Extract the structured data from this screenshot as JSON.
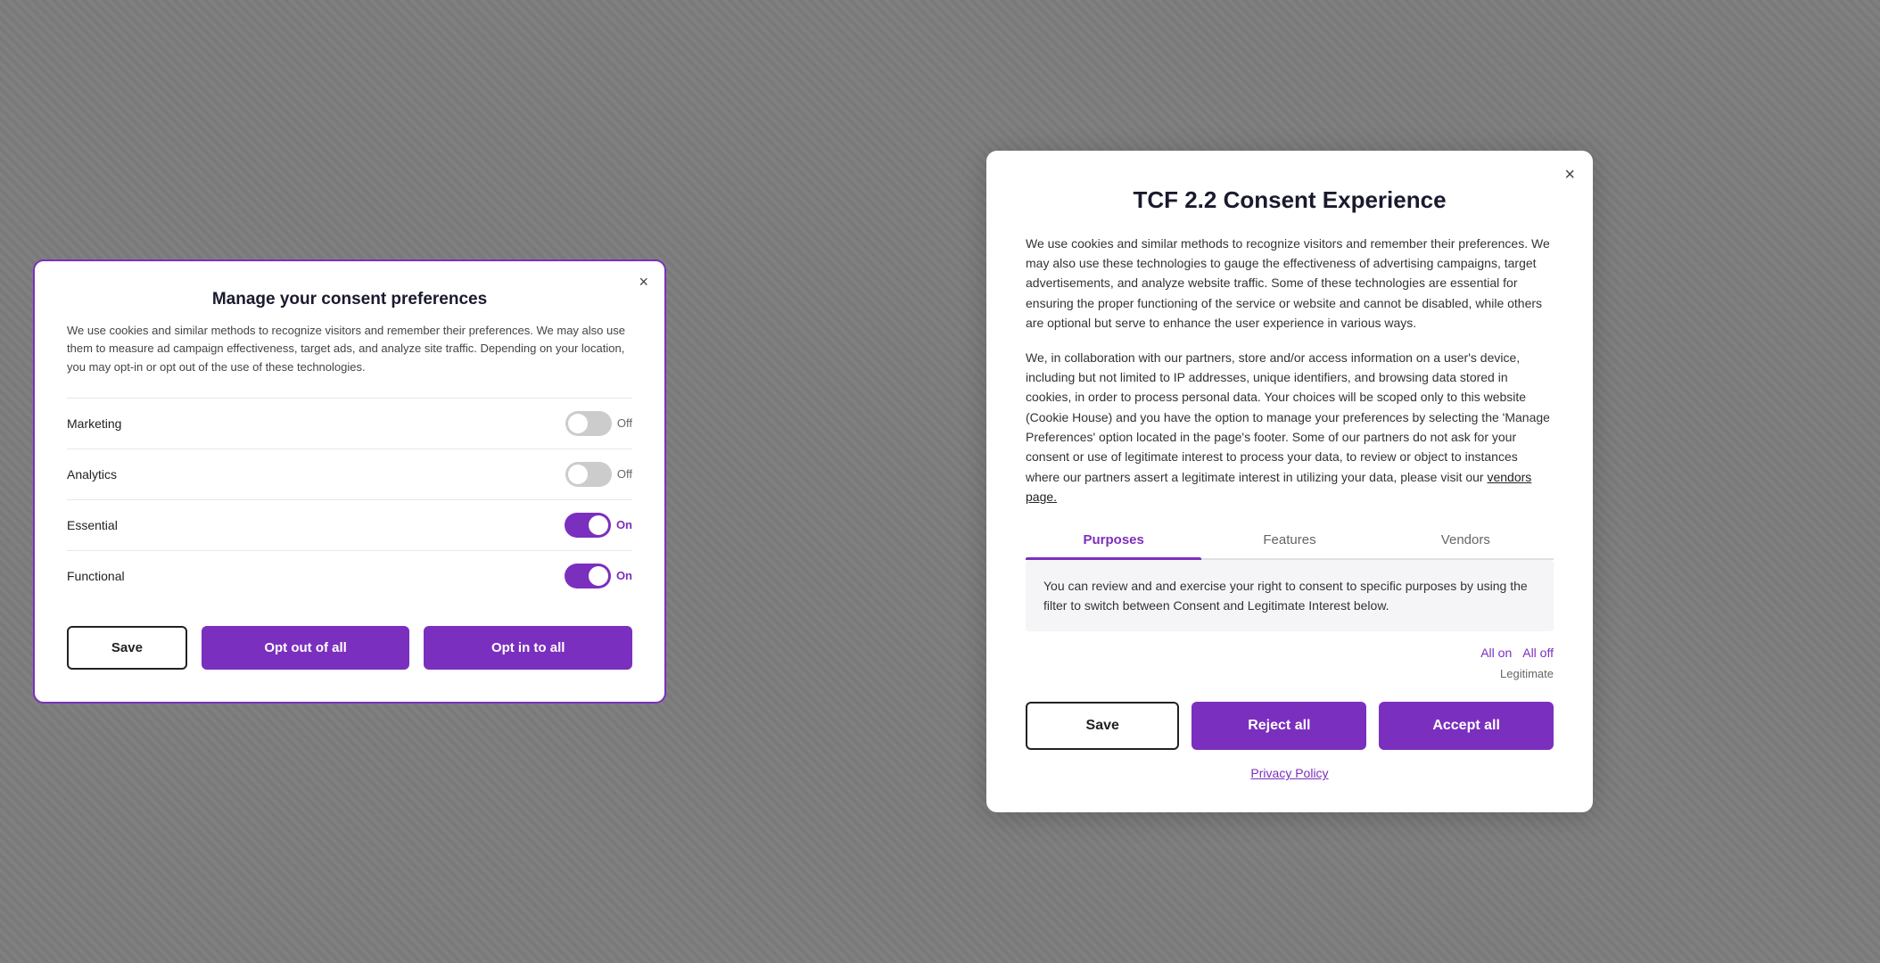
{
  "left_modal": {
    "title": "Manage your consent preferences",
    "description": "We use cookies and similar methods to recognize visitors and remember their preferences. We may also use them to measure ad campaign effectiveness, target ads, and analyze site traffic. Depending on your location, you may opt-in or opt out of the use of these technologies.",
    "close_label": "×",
    "consent_items": [
      {
        "label": "Marketing",
        "state": "off"
      },
      {
        "label": "Analytics",
        "state": "off"
      },
      {
        "label": "Essential",
        "state": "on"
      },
      {
        "label": "Functional",
        "state": "on"
      }
    ],
    "buttons": {
      "save": "Save",
      "opt_out": "Opt out of all",
      "opt_in": "Opt in to all"
    }
  },
  "right_modal": {
    "title": "TCF 2.2 Consent Experience",
    "close_label": "×",
    "description1": "We use cookies and similar methods to recognize visitors and remember their preferences. We may also use these technologies to gauge the effectiveness of advertising campaigns, target advertisements, and analyze website traffic. Some of these technologies are essential for ensuring the proper functioning of the service or website and cannot be disabled, while others are optional but serve to enhance the user experience in various ways.",
    "description2": "We, in collaboration with our partners, store and/or access information on a user's device, including but not limited to IP addresses, unique identifiers, and browsing data stored in cookies, in order to process personal data. Your choices will be scoped only to this website (Cookie House) and you have the option to manage your preferences by selecting the 'Manage Preferences' option located in the page's footer. Some of our partners do not ask for your consent or use of legitimate interest to process your data, to review or object to instances where our partners assert a legitimate interest in utilizing your data, please visit our",
    "vendors_link": "vendors page.",
    "tabs": [
      {
        "label": "Purposes",
        "active": true
      },
      {
        "label": "Features",
        "active": false
      },
      {
        "label": "Vendors",
        "active": false
      }
    ],
    "tab_content": "You can review and and exercise your right to consent to specific purposes by using the filter to switch between Consent and Legitimate Interest below.",
    "all_on_label": "All on",
    "all_off_label": "All off",
    "legitimate_label": "Legitimate",
    "buttons": {
      "save": "Save",
      "reject_all": "Reject all",
      "accept_all": "Accept all"
    },
    "privacy_policy_label": "Privacy Policy"
  }
}
